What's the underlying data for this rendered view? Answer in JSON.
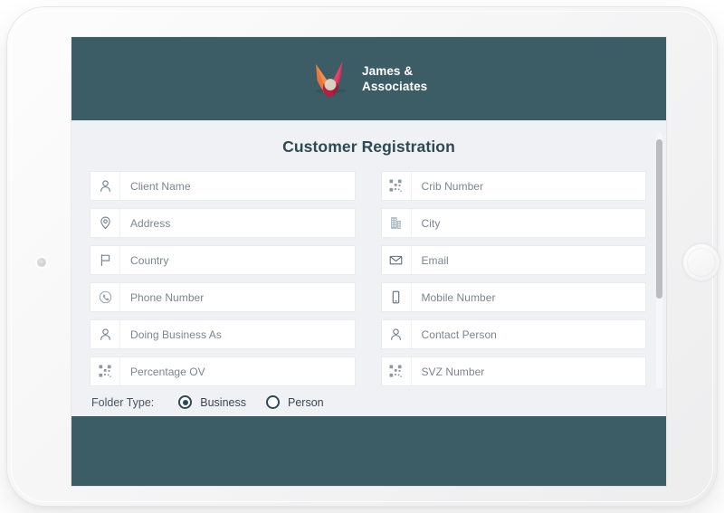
{
  "device": {
    "type": "tablet",
    "orientation": "landscape",
    "camera_icon": "camera-dot-icon",
    "home_button_icon": "home-button-icon"
  },
  "theme": {
    "header_color": "#3c5c66",
    "footer_color": "#3c5c66",
    "panel_background": "#eff1f5",
    "field_background": "#ffffff",
    "title_color": "#2d4a54",
    "placeholder_color": "#7c8590",
    "logo_orange": "#e8763c",
    "logo_pink": "#cf2f5c",
    "logo_crimson": "#b02040",
    "logo_center": "#ddd0c2",
    "scrollbar_thumb": "#bcbcbe"
  },
  "header": {
    "logo_icon": "company-logo-icon",
    "brand_name": "James & Associates",
    "brand_line_1": "James &",
    "brand_line_2": "Associates"
  },
  "main": {
    "title": "Customer Registration",
    "fields_left": [
      {
        "icon": "person-icon",
        "placeholder": "Client Name"
      },
      {
        "icon": "map-pin-icon",
        "placeholder": "Address"
      },
      {
        "icon": "flag-icon",
        "placeholder": "Country"
      },
      {
        "icon": "phone-circle-icon",
        "placeholder": "Phone Number"
      },
      {
        "icon": "person-icon",
        "placeholder": "Doing Business As"
      },
      {
        "icon": "qr-code-icon",
        "placeholder": "Percentage OV"
      }
    ],
    "fields_right": [
      {
        "icon": "qr-code-icon",
        "placeholder": "Crib Number"
      },
      {
        "icon": "building-icon",
        "placeholder": "City"
      },
      {
        "icon": "envelope-icon",
        "placeholder": "Email"
      },
      {
        "icon": "mobile-icon",
        "placeholder": "Mobile Number"
      },
      {
        "icon": "person-icon",
        "placeholder": "Contact Person"
      },
      {
        "icon": "qr-code-icon",
        "placeholder": "SVZ Number"
      }
    ],
    "folder_type": {
      "label": "Folder Type:",
      "options": [
        {
          "label": "Business",
          "selected": true
        },
        {
          "label": "Person",
          "selected": false
        }
      ]
    },
    "scrollbar": {
      "visible": true
    }
  }
}
